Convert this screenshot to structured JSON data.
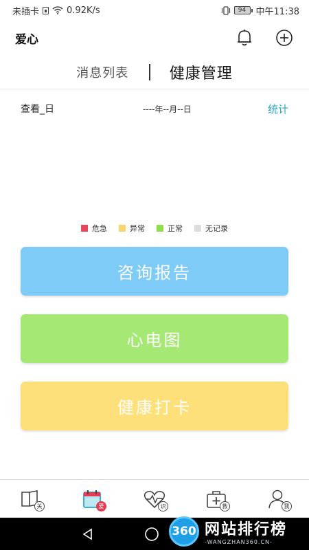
{
  "status_bar": {
    "carrier": "未插卡",
    "speed": "0.92K/s",
    "battery": "94",
    "time": "中午11:38"
  },
  "header": {
    "title": "爱心",
    "icons": [
      "bell-icon",
      "add-circle-icon"
    ]
  },
  "tabs": [
    {
      "label": "消息列表",
      "active": false
    },
    {
      "label": "健康管理",
      "active": true
    }
  ],
  "filter": {
    "view_label": "查看_日",
    "date_range": "----年--月--日",
    "stats_label": "统计"
  },
  "legend": [
    {
      "label": "危急",
      "color": "#e8465a"
    },
    {
      "label": "异常",
      "color": "#fbd46e"
    },
    {
      "label": "正常",
      "color": "#8de049"
    },
    {
      "label": "无记录",
      "color": "#dcdcdc"
    }
  ],
  "actions": {
    "report": "咨询报告",
    "ecg": "心电图",
    "checkin": "健康打卡"
  },
  "bottom_nav": [
    {
      "badge": "关",
      "icon": "book-icon",
      "active": false
    },
    {
      "badge": "爱",
      "icon": "calendar-icon",
      "active": true
    },
    {
      "badge": "识",
      "icon": "heart-pulse-icon",
      "active": false
    },
    {
      "badge": "救",
      "icon": "medical-kit-icon",
      "active": false
    },
    {
      "badge": "我",
      "icon": "user-icon",
      "active": false
    }
  ],
  "system_nav": [
    "back-icon",
    "home-icon",
    "recents-icon"
  ],
  "watermark": {
    "logo": "360",
    "title": "网站排行榜",
    "subtitle": "-WANGZHAN360.CN-"
  },
  "colors": {
    "accent": "#2aa6c6",
    "report": "#7ecbf8",
    "ecg": "#a6e874",
    "checkin": "#fde07a",
    "active_badge": "#e23c55"
  }
}
